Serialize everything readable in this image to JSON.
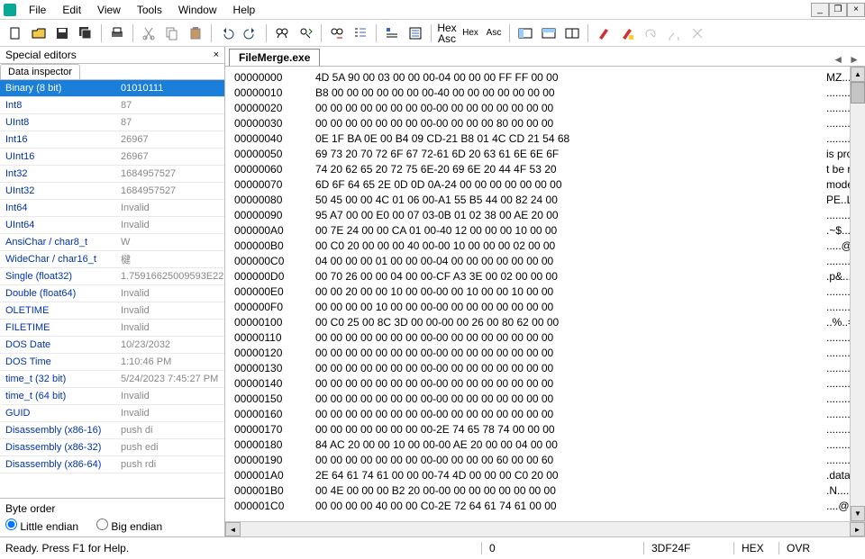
{
  "menu": {
    "items": [
      "File",
      "Edit",
      "View",
      "Tools",
      "Window",
      "Help"
    ]
  },
  "window": {
    "min": "_",
    "max": "❐",
    "close": "×"
  },
  "toolbar": {
    "btns": [
      "new",
      "open",
      "save",
      "saveall",
      "print",
      "cut",
      "copy",
      "paste",
      "undo",
      "redo",
      "find",
      "findnext",
      "replace",
      "listbm",
      "opts1",
      "opts2"
    ],
    "hexasc_stack": [
      "Hex",
      "Asc"
    ],
    "hex_label": "Hex",
    "asc_label": "Asc",
    "layout": [
      "layout1",
      "layout2",
      "layout3"
    ],
    "markers": [
      "m1",
      "m2",
      "m3",
      "m4",
      "m5"
    ]
  },
  "panel": {
    "title": "Special editors",
    "tab": "Data inspector"
  },
  "inspector": [
    {
      "k": "Binary (8 bit)",
      "v": "01010111",
      "sel": true
    },
    {
      "k": "Int8",
      "v": "87"
    },
    {
      "k": "UInt8",
      "v": "87"
    },
    {
      "k": "Int16",
      "v": "26967"
    },
    {
      "k": "UInt16",
      "v": "26967"
    },
    {
      "k": "Int32",
      "v": "1684957527"
    },
    {
      "k": "UInt32",
      "v": "1684957527"
    },
    {
      "k": "Int64",
      "v": "Invalid"
    },
    {
      "k": "UInt64",
      "v": "Invalid"
    },
    {
      "k": "AnsiChar / char8_t",
      "v": "W"
    },
    {
      "k": "WideChar / char16_t",
      "v": "楗"
    },
    {
      "k": "Single (float32)",
      "v": "1.75916625009593E22"
    },
    {
      "k": "Double (float64)",
      "v": "Invalid"
    },
    {
      "k": "OLETIME",
      "v": "Invalid"
    },
    {
      "k": "FILETIME",
      "v": "Invalid"
    },
    {
      "k": "DOS Date",
      "v": "10/23/2032"
    },
    {
      "k": "DOS Time",
      "v": "1:10:46 PM"
    },
    {
      "k": "time_t (32 bit)",
      "v": "5/24/2023 7:45:27 PM"
    },
    {
      "k": "time_t (64 bit)",
      "v": "Invalid"
    },
    {
      "k": "GUID",
      "v": "Invalid"
    },
    {
      "k": "Disassembly (x86-16)",
      "v": "push di"
    },
    {
      "k": "Disassembly (x86-32)",
      "v": "push edi"
    },
    {
      "k": "Disassembly (x86-64)",
      "v": "push rdi"
    }
  ],
  "byteorder": {
    "label": "Byte order",
    "little": "Little endian",
    "big": "Big endian",
    "selected": "little"
  },
  "file_tab": "FileMerge.exe",
  "hex": [
    {
      "o": "00000000",
      "b": "4D 5A 90 00 03 00 00 00-04 00 00 00 FF FF 00 00",
      "a": "MZ......"
    },
    {
      "o": "00000010",
      "b": "B8 00 00 00 00 00 00 00-40 00 00 00 00 00 00 00",
      "a": "........"
    },
    {
      "o": "00000020",
      "b": "00 00 00 00 00 00 00 00-00 00 00 00 00 00 00 00",
      "a": "........"
    },
    {
      "o": "00000030",
      "b": "00 00 00 00 00 00 00 00-00 00 00 00 80 00 00 00",
      "a": "........"
    },
    {
      "o": "00000040",
      "b": "0E 1F BA 0E 00 B4 09 CD-21 B8 01 4C CD 21 54 68",
      "a": "........"
    },
    {
      "o": "00000050",
      "b": "69 73 20 70 72 6F 67 72-61 6D 20 63 61 6E 6E 6F",
      "a": "is prog"
    },
    {
      "o": "00000060",
      "b": "74 20 62 65 20 72 75 6E-20 69 6E 20 44 4F 53 20",
      "a": "t be ru"
    },
    {
      "o": "00000070",
      "b": "6D 6F 64 65 2E 0D 0D 0A-24 00 00 00 00 00 00 00",
      "a": "mode..."
    },
    {
      "o": "00000080",
      "b": "50 45 00 00 4C 01 06 00-A1 55 B5 44 00 82 24 00",
      "a": "PE..L.."
    },
    {
      "o": "00000090",
      "b": "95 A7 00 00 E0 00 07 03-0B 01 02 38 00 AE 20 00",
      "a": "........"
    },
    {
      "o": "000000A0",
      "b": "00 7E 24 00 00 CA 01 00-40 12 00 00 00 10 00 00",
      "a": ".~$....."
    },
    {
      "o": "000000B0",
      "b": "00 C0 20 00 00 00 40 00-00 10 00 00 00 02 00 00",
      "a": ".....@"
    },
    {
      "o": "000000C0",
      "b": "04 00 00 00 01 00 00 00-04 00 00 00 00 00 00 00",
      "a": "........"
    },
    {
      "o": "000000D0",
      "b": "00 70 26 00 00 04 00 00-CF A3 3E 00 02 00 00 00",
      "a": ".p&....."
    },
    {
      "o": "000000E0",
      "b": "00 00 20 00 00 10 00 00-00 00 10 00 00 10 00 00",
      "a": "........"
    },
    {
      "o": "000000F0",
      "b": "00 00 00 00 10 00 00 00-00 00 00 00 00 00 00 00",
      "a": "........"
    },
    {
      "o": "00000100",
      "b": "00 C0 25 00 8C 3D 00 00-00 00 26 00 80 62 00 00",
      "a": "..%..=."
    },
    {
      "o": "00000110",
      "b": "00 00 00 00 00 00 00 00-00 00 00 00 00 00 00 00",
      "a": "........"
    },
    {
      "o": "00000120",
      "b": "00 00 00 00 00 00 00 00-00 00 00 00 00 00 00 00",
      "a": "........"
    },
    {
      "o": "00000130",
      "b": "00 00 00 00 00 00 00 00-00 00 00 00 00 00 00 00",
      "a": "........"
    },
    {
      "o": "00000140",
      "b": "00 00 00 00 00 00 00 00-00 00 00 00 00 00 00 00",
      "a": "........"
    },
    {
      "o": "00000150",
      "b": "00 00 00 00 00 00 00 00-00 00 00 00 00 00 00 00",
      "a": "........"
    },
    {
      "o": "00000160",
      "b": "00 00 00 00 00 00 00 00-00 00 00 00 00 00 00 00",
      "a": "........"
    },
    {
      "o": "00000170",
      "b": "00 00 00 00 00 00 00 00-2E 74 65 78 74 00 00 00",
      "a": "........"
    },
    {
      "o": "00000180",
      "b": "84 AC 20 00 00 10 00 00-00 AE 20 00 00 04 00 00",
      "a": "........"
    },
    {
      "o": "00000190",
      "b": "00 00 00 00 00 00 00 00-00 00 00 00 60 00 00 60",
      "a": "........"
    },
    {
      "o": "000001A0",
      "b": "2E 64 61 74 61 00 00 00-74 4D 00 00 00 C0 20 00",
      "a": ".data.."
    },
    {
      "o": "000001B0",
      "b": "00 4E 00 00 00 B2 20 00-00 00 00 00 00 00 00 00",
      "a": ".N......"
    },
    {
      "o": "000001C0",
      "b": "00 00 00 00 40 00 00 C0-2E 72 64 61 74 61 00 00",
      "a": "....@..."
    }
  ],
  "status": {
    "ready": "Ready.  Press F1 for Help.",
    "offset": "0",
    "size": "3DF24F",
    "mode": "HEX",
    "ins": "OVR"
  }
}
